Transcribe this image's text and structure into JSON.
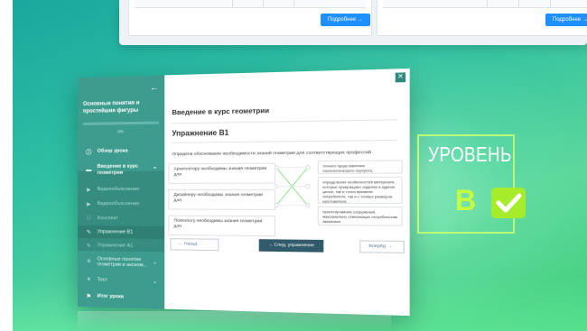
{
  "top_strip": {
    "cards": [
      {
        "button_label": "Подробнее →"
      },
      {
        "button_label": "Подробнее →"
      }
    ]
  },
  "sidebar": {
    "title": "Основные понятия и простейшие фигуры",
    "progress_percent": 0,
    "progress_label": "0%",
    "items": [
      {
        "label": "Обзор урока",
        "icon": "info-icon"
      },
      {
        "label": "Введение в курс геометрии",
        "icon": "chat-icon"
      },
      {
        "label": "Видеообъяснение",
        "icon": "play-icon"
      },
      {
        "label": "Видеообъяснение",
        "icon": "play-icon"
      },
      {
        "label": "Конспект",
        "icon": "document-icon"
      },
      {
        "label": "Упражнение В1",
        "icon": "edit-icon"
      },
      {
        "label": "Упражнение А1",
        "icon": "edit-icon"
      },
      {
        "label": "Основные понятия геометрии и аксиом...",
        "icon": "list-icon"
      },
      {
        "label": "Тест",
        "icon": "list-icon"
      },
      {
        "label": "Итог урока",
        "icon": "flag-icon"
      }
    ]
  },
  "content": {
    "course_title": "Введение в курс геометрии",
    "exercise_title": "Упражнение В1",
    "task": "Определи обоснование необходимости знаний геометрии для соответствующих профессий.",
    "left_items": [
      "Архитектору необходимы знания геометрии для",
      "Дизайнеру необходимы знания геометрии для",
      "Психологу необходимы знания геометрии для"
    ],
    "right_items": [
      "точного представления психологического портрета.",
      "определения особенностей материала, которые превращают изделие в единое целое, так и точно времени потребителя, так и с точных размеров изготовителя.",
      "проектирования сооружений, максимально отвечающих потребностям заказчика."
    ],
    "back_label": "← Назад",
    "next_label": "→ След. упражнение",
    "further_label": "Вперёд →"
  },
  "level_badge": {
    "title": "УРОВЕНЬ",
    "letter": "В",
    "accent": "#b9ff7a"
  }
}
